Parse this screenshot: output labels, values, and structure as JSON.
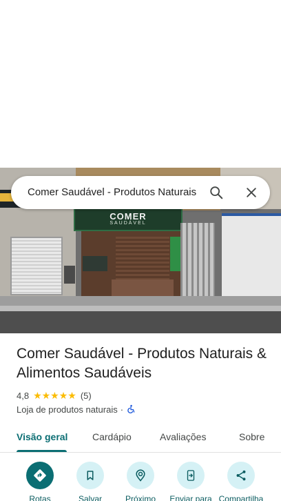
{
  "search": {
    "query": "Comer Saudável - Produtos Naturais",
    "search_icon": "search-icon",
    "close_icon": "close-icon"
  },
  "photo": {
    "sign_brand": "COMER",
    "sign_subtitle": "SAUDÁVEL"
  },
  "place": {
    "title": "Comer Saudável - Produtos Naturais & Alimentos Saudáveis",
    "rating": "4,8",
    "stars": "★★★★★",
    "review_count": "(5)",
    "category": "Loja de produtos naturais",
    "separator": "·",
    "accessibility_icon": "wheelchair-icon"
  },
  "tabs": [
    {
      "label": "Visão geral",
      "active": true
    },
    {
      "label": "Cardápio",
      "active": false
    },
    {
      "label": "Avaliações",
      "active": false
    },
    {
      "label": "Sobre",
      "active": false
    }
  ],
  "actions": [
    {
      "label": "Rotas",
      "icon": "directions-icon"
    },
    {
      "label": "Salvar",
      "icon": "bookmark-icon"
    },
    {
      "label": "Próximo",
      "icon": "nearby-icon"
    },
    {
      "label": "Enviar para",
      "icon": "send-to-phone-icon"
    },
    {
      "label": "Compartilha",
      "icon": "share-icon"
    }
  ],
  "colors": {
    "accent": "#0b6e73",
    "action_bg": "#d5f1f5",
    "star": "#fbbc04"
  }
}
